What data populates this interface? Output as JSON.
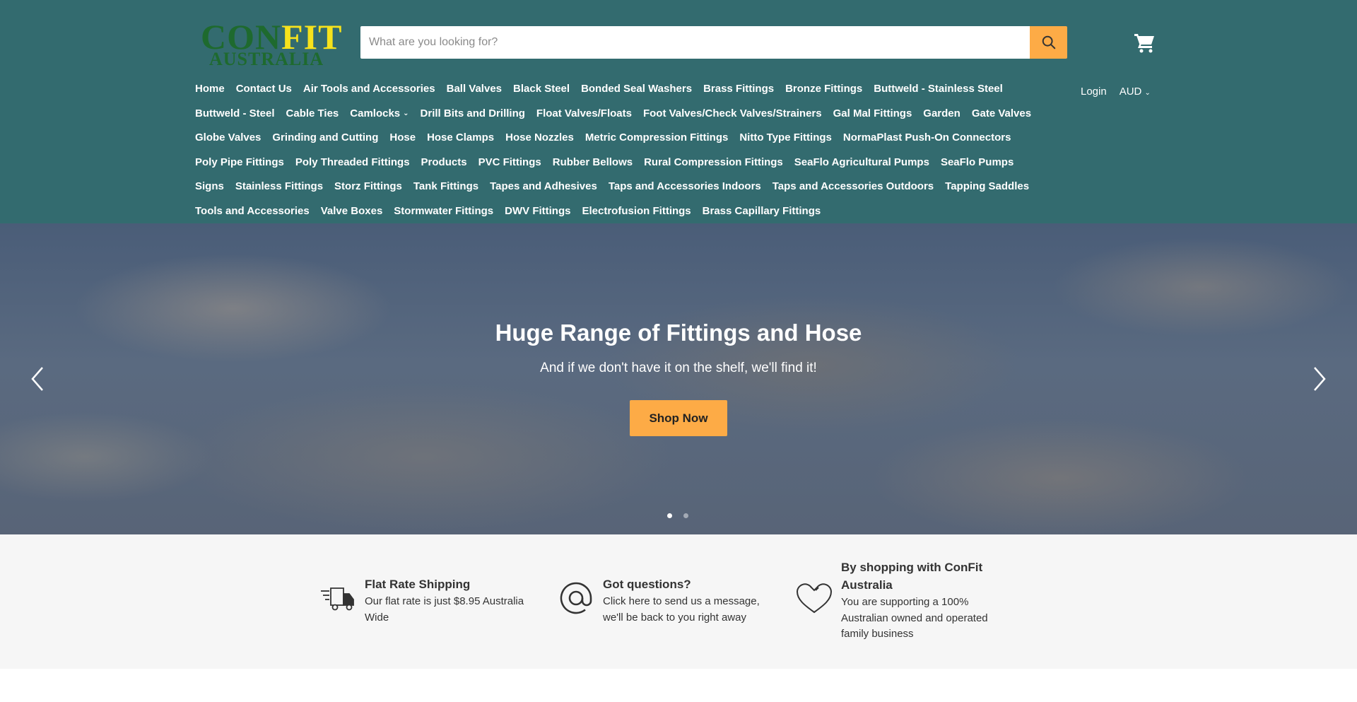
{
  "logo": {
    "part1": "CON",
    "part2": "FIT",
    "line2": "AUSTRALIA",
    "color_primary": "#1e6a2e",
    "color_accent": "#f6e21c"
  },
  "search": {
    "placeholder": "What are you looking for?",
    "value": "",
    "icon": "search-icon"
  },
  "cart": {
    "icon": "cart-icon"
  },
  "nav": {
    "items": [
      "Home",
      "Contact Us",
      "Air Tools and Accessories",
      "Ball Valves",
      "Black Steel",
      "Bonded Seal Washers",
      "Brass Fittings",
      "Bronze Fittings",
      "Buttweld - Stainless Steel",
      "Buttweld - Steel",
      "Cable Ties",
      "Camlocks",
      "Drill Bits and Drilling",
      "Float Valves/Floats",
      "Foot Valves/Check Valves/Strainers",
      "Gal Mal Fittings",
      "Garden",
      "Gate Valves",
      "Globe Valves",
      "Grinding and Cutting",
      "Hose",
      "Hose Clamps",
      "Hose Nozzles",
      "Metric Compression Fittings",
      "Nitto Type Fittings",
      "NormaPlast Push-On Connectors",
      "Poly Pipe Fittings",
      "Poly Threaded Fittings",
      "Products",
      "PVC Fittings",
      "Rubber Bellows",
      "Rural Compression Fittings",
      "SeaFlo Agricultural Pumps",
      "SeaFlo Pumps",
      "Signs",
      "Stainless Fittings",
      "Storz Fittings",
      "Tank Fittings",
      "Tapes and Adhesives",
      "Taps and Accessories Indoors",
      "Taps and Accessories Outdoors",
      "Tapping Saddles",
      "Tools and Accessories",
      "Valve Boxes",
      "Stormwater Fittings",
      "DWV Fittings",
      "Electrofusion Fittings",
      "Brass Capillary Fittings"
    ],
    "dropdown_item": "Camlocks"
  },
  "account": {
    "login": "Login",
    "currency": "AUD"
  },
  "hero": {
    "title": "Huge Range of Fittings and Hose",
    "subtitle": "And if we don't have it on the shelf, we'll find it!",
    "button": "Shop Now",
    "slide_count": 2,
    "active_slide": 1
  },
  "promos": [
    {
      "icon": "truck-icon",
      "title": "Flat Rate Shipping",
      "body": "Our flat rate is just $8.95 Australia Wide"
    },
    {
      "icon": "at-sign-icon",
      "title": "Got questions?",
      "body": "Click here to send us a message, we'll be back to you right away"
    },
    {
      "icon": "heart-icon",
      "title": "By shopping with ConFit Australia",
      "body": "You are supporting a 100% Australian owned and operated family business"
    }
  ],
  "colors": {
    "header_bg": "#336b6f",
    "accent": "#fdab46",
    "promo_bg": "#f6f6f6"
  }
}
